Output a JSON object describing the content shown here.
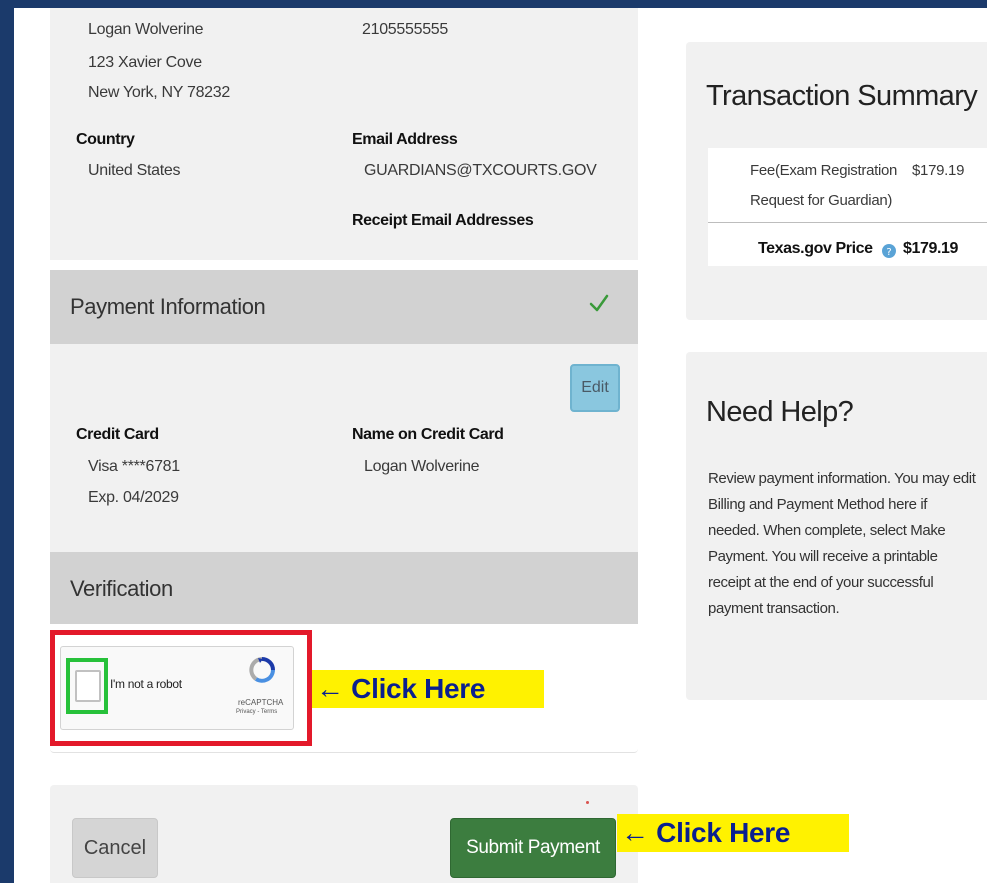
{
  "billing": {
    "name": "Logan Wolverine",
    "address_line1": "123 Xavier Cove",
    "address_line2": "New York, NY 78232",
    "phone": "2105555555",
    "country_label": "Country",
    "country_value": "United States",
    "email_label": "Email Address",
    "email_value": "GUARDIANS@TXCOURTS.GOV",
    "receipt_label": "Receipt Email Addresses"
  },
  "payment": {
    "title": "Payment Information",
    "edit_label": "Edit",
    "card_label": "Credit Card",
    "card_value": "Visa ****6781",
    "card_exp": "Exp. 04/2029",
    "name_label": "Name on Credit Card",
    "name_value": "Logan Wolverine"
  },
  "verification": {
    "title": "Verification",
    "recaptcha_label": "I'm not a robot",
    "recaptcha_brand": "reCAPTCHA",
    "recaptcha_links": "Privacy - Terms"
  },
  "callouts": {
    "click_here_1": "← Click Here",
    "click_here_2": "← Click Here"
  },
  "actions": {
    "cancel_label": "Cancel",
    "submit_label": "Submit Payment"
  },
  "summary": {
    "title": "Transaction Summary",
    "fee_line1": "Fee(Exam Registration",
    "fee_line2": "Request for Guardian)",
    "fee_amount": "$179.19",
    "price_label": "Texas.gov Price",
    "price_amount": "$179.19"
  },
  "help": {
    "title": "Need Help?",
    "text": "Review payment information. You may edit Billing and Payment Method here if needed. When complete, select Make Payment. You will receive a printable receipt at the end of your successful payment transaction."
  },
  "colors": {
    "frame": "#1b3a6b",
    "submit": "#3c7d3f",
    "edit": "#8ac7df",
    "callout_bg": "#fff200",
    "callout_text": "#0a1f8f",
    "highlight_red": "#e3192a",
    "highlight_green": "#27c13a"
  }
}
